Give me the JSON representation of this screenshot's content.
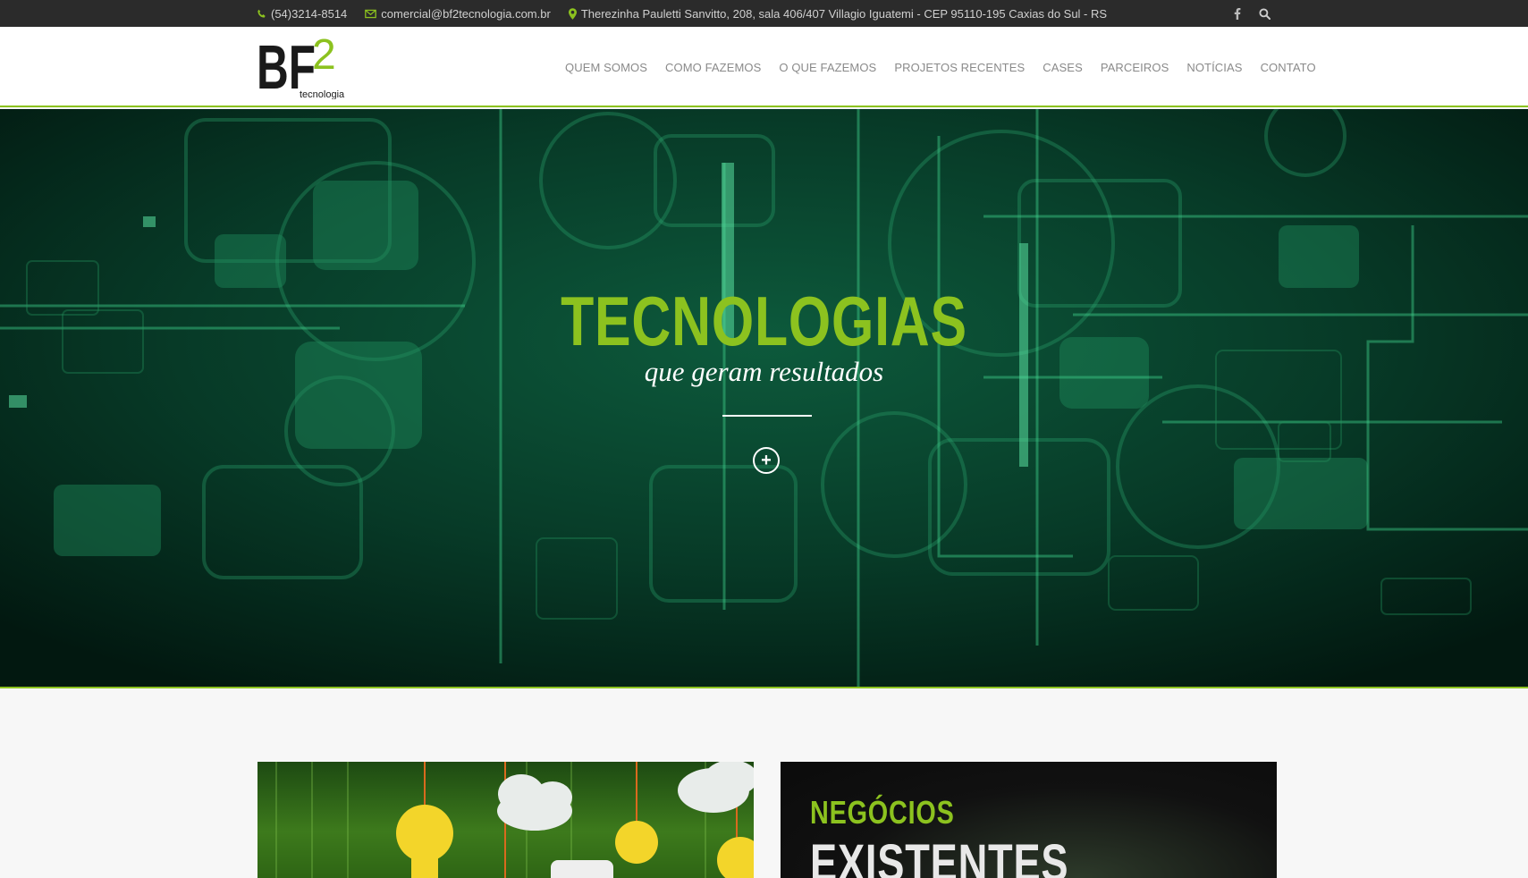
{
  "topbar": {
    "phone": "(54)3214-8514",
    "email": "comercial@bf2tecnologia.com.br",
    "address": "Therezinha Pauletti Sanvitto, 208, sala 406/407 Villagio Iguatemi - CEP 95110-195 Caxias do Sul - RS",
    "icons": [
      "phone-icon",
      "envelope-icon",
      "map-marker-icon",
      "facebook-icon",
      "search-icon"
    ]
  },
  "logo": {
    "main": "BF",
    "digit": "2",
    "tagline": "tecnologia"
  },
  "nav": {
    "items": [
      {
        "label": "QUEM SOMOS"
      },
      {
        "label": "COMO FAZEMOS"
      },
      {
        "label": "O QUE FAZEMOS"
      },
      {
        "label": "PROJETOS RECENTES"
      },
      {
        "label": "CASES"
      },
      {
        "label": "PARCEIROS"
      },
      {
        "label": "NOTÍCIAS"
      },
      {
        "label": "CONTATO"
      }
    ]
  },
  "hero": {
    "title": "TECNOLOGIAS",
    "subtitle": "que geram resultados",
    "more_icon": "plus-circle-icon"
  },
  "cards": {
    "right": {
      "kicker": "NEGÓCIOS",
      "title": "EXISTENTES"
    }
  },
  "colors": {
    "accent": "#8cc21f",
    "topbar_bg": "#2b2b2b",
    "hero_bg": "#04231a",
    "nav_text": "#8a8a8a"
  }
}
